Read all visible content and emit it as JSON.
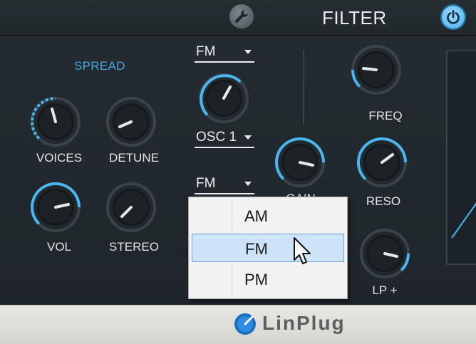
{
  "header": {
    "title": "FILTER",
    "settings_icon": "wrench-icon",
    "power_icon": "power-icon"
  },
  "spread": {
    "section_label": "SPREAD",
    "knobs": {
      "voices": "VOICES",
      "detune": "DETUNE",
      "vol": "VOL",
      "stereo": "STEREO"
    }
  },
  "modulation": {
    "mode_dropdown_1": "FM",
    "source_dropdown": "OSC 1",
    "mode_dropdown_2": "FM"
  },
  "filter": {
    "knobs": {
      "freq": "FREQ",
      "reso": "RESO",
      "gain": "GAIN",
      "type": "LP +"
    }
  },
  "dropdown_menu": {
    "items": [
      "AM",
      "FM",
      "PM"
    ],
    "selected": "FM"
  },
  "footer": {
    "brand": "LinPlug"
  },
  "colors": {
    "accent": "#4aa8e0",
    "arc": "#49b6f0",
    "background": "#20272c",
    "footer": "#e2e0db"
  }
}
